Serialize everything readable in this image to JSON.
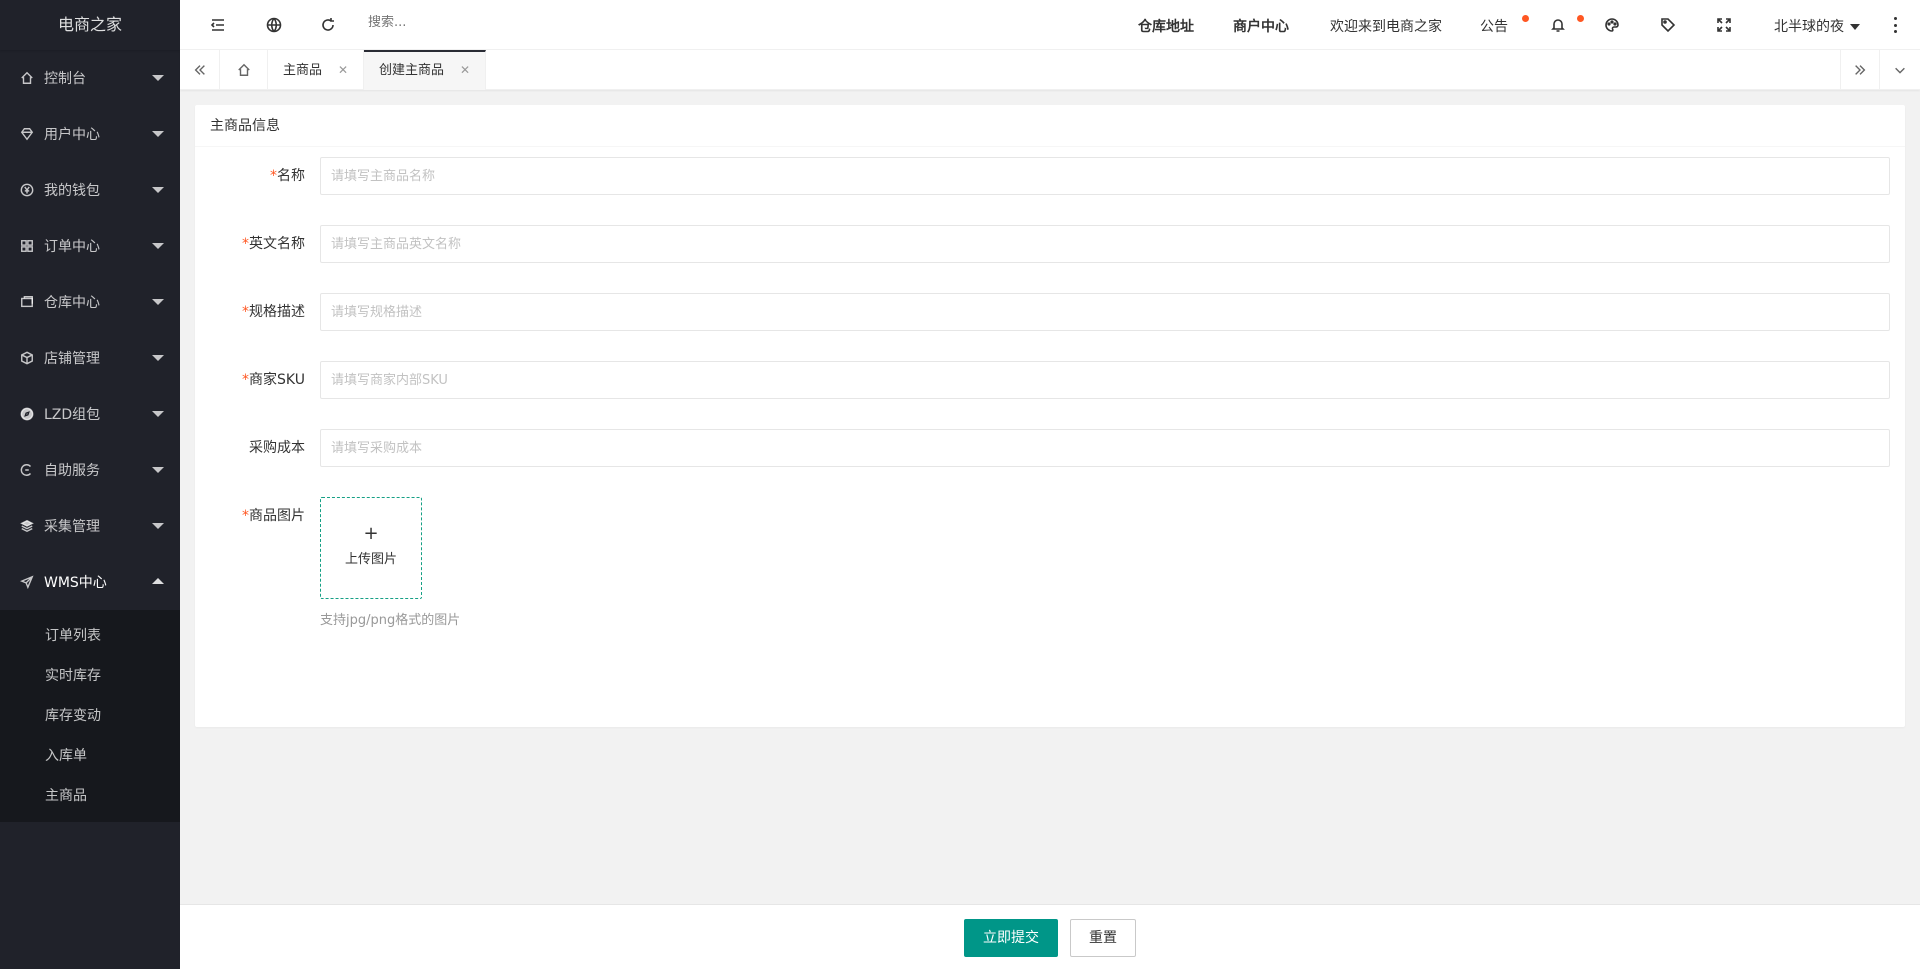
{
  "sidebar": {
    "logo": "电商之家",
    "items": [
      {
        "label": "控制台",
        "icon": "home-icon"
      },
      {
        "label": "用户中心",
        "icon": "diamond-icon"
      },
      {
        "label": "我的钱包",
        "icon": "yen-icon"
      },
      {
        "label": "订单中心",
        "icon": "apps-icon"
      },
      {
        "label": "仓库中心",
        "icon": "warehouse-icon"
      },
      {
        "label": "店铺管理",
        "icon": "box-icon"
      },
      {
        "label": "LZD组包",
        "icon": "compass-icon"
      },
      {
        "label": "自助服务",
        "icon": "service-icon"
      },
      {
        "label": "采集管理",
        "icon": "layers-icon"
      },
      {
        "label": "WMS中心",
        "icon": "send-icon"
      }
    ],
    "wms_sub": [
      "订单列表",
      "实时库存",
      "库存变动",
      "入库单",
      "主商品"
    ]
  },
  "header": {
    "search_placeholder": "搜索...",
    "warehouse_address": "仓库地址",
    "merchant_center": "商户中心",
    "welcome": "欢迎来到电商之家",
    "notice": "公告",
    "username": "北半球的夜",
    "notify_dot_color": "#ff5722"
  },
  "tabs": {
    "items": [
      {
        "label": "主商品"
      },
      {
        "label": "创建主商品"
      }
    ]
  },
  "form": {
    "section_title": "主商品信息",
    "fields": [
      {
        "label": "名称",
        "placeholder": "请填写主商品名称",
        "required": "*"
      },
      {
        "label": "英文名称",
        "placeholder": "请填写主商品英文名称",
        "required": "*"
      },
      {
        "label": "规格描述",
        "placeholder": "请填写规格描述",
        "required": "*"
      },
      {
        "label": "商家SKU",
        "placeholder": "请填写商家内部SKU",
        "required": "*"
      },
      {
        "label": "采购成本",
        "placeholder": "请填写采购成本",
        "required": ""
      }
    ],
    "image_label": "商品图片",
    "image_required": "*",
    "upload_plus": "+",
    "upload_text": "上传图片",
    "upload_hint": "支持jpg/png格式的图片"
  },
  "footer": {
    "submit": "立即提交",
    "reset": "重置",
    "accent_color": "#009688"
  }
}
